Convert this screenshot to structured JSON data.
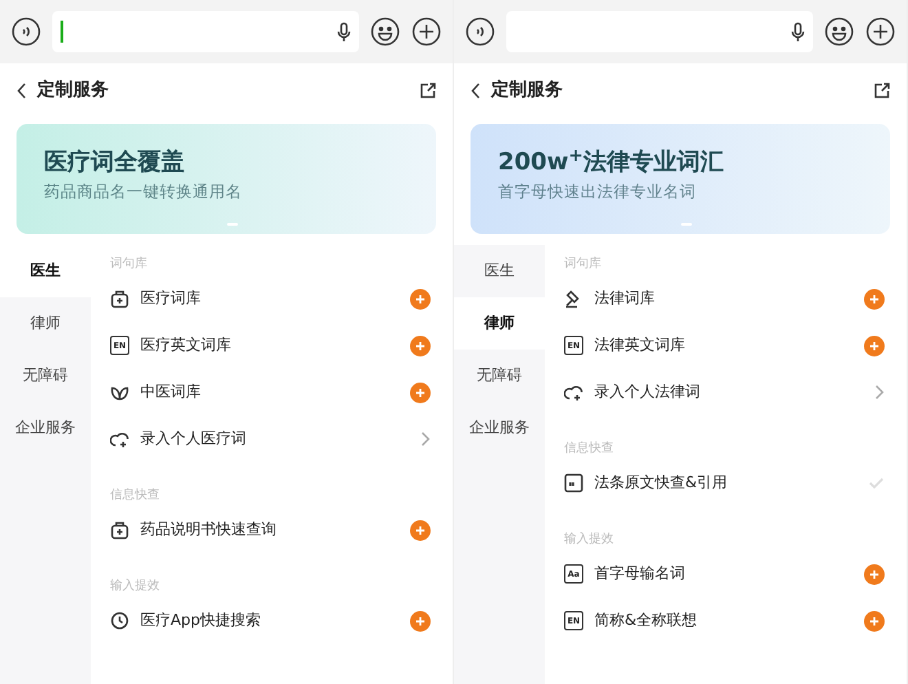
{
  "panels": [
    {
      "input": {
        "focused": true
      },
      "header": {
        "title": "定制服务"
      },
      "banner": {
        "title": "医疗词全覆盖",
        "subtitle": "药品商品名一键转换通用名",
        "color": "#c4efe6"
      },
      "sidebar": [
        {
          "label": "医生",
          "selected": true
        },
        {
          "label": "律师",
          "selected": false
        },
        {
          "label": "无障碍",
          "selected": false
        },
        {
          "label": "企业服务",
          "selected": false
        }
      ],
      "sections": [
        {
          "label": "词句库",
          "items": [
            {
              "kind": "medical",
              "label": "医疗词库",
              "added": false
            },
            {
              "kind": "tag",
              "icon_text": "EN",
              "label": "医疗英文词库",
              "added": false
            },
            {
              "kind": "herbal",
              "label": "中医词库",
              "added": false
            },
            {
              "kind": "custom",
              "label": "录入个人医疗词"
            }
          ]
        },
        {
          "label": "信息快查",
          "items": [
            {
              "kind": "medical",
              "label": "药品说明书快速查询",
              "added": false
            }
          ]
        },
        {
          "label": "输入提效",
          "items": [
            {
              "kind": "search",
              "label": "医疗App快捷搜索",
              "added": false
            }
          ]
        }
      ]
    },
    {
      "input": {
        "focused": false
      },
      "header": {
        "title": "定制服务"
      },
      "banner": {
        "title": "200w$^{+}$法律专业词汇",
        "subtitle": "首字母快速出法律专业名词",
        "color": "#cfe2fa"
      },
      "sidebar": [
        {
          "label": "医生",
          "selected": false
        },
        {
          "label": "律师",
          "selected": true
        },
        {
          "label": "无障碍",
          "selected": false
        },
        {
          "label": "企业服务",
          "selected": false
        }
      ],
      "sections": [
        {
          "label": "词句库",
          "items": [
            {
              "kind": "legal",
              "label": "法律词库",
              "added": false
            },
            {
              "kind": "tag",
              "icon_text": "EN",
              "label": "法律英文词库",
              "added": false
            },
            {
              "kind": "custom",
              "label": "录入个人法律词"
            }
          ]
        },
        {
          "label": "信息快查",
          "items": [
            {
              "kind": "citation",
              "label": "法条原文快查&引用",
              "added": true
            }
          ]
        },
        {
          "label": "输入提效",
          "items": [
            {
              "kind": "tag",
              "icon_text": "Aa",
              "label": "首字母输名词",
              "added": false
            },
            {
              "kind": "tag",
              "icon_text": "EN",
              "label": "简称&全称联想",
              "added": false
            }
          ]
        }
      ]
    }
  ]
}
